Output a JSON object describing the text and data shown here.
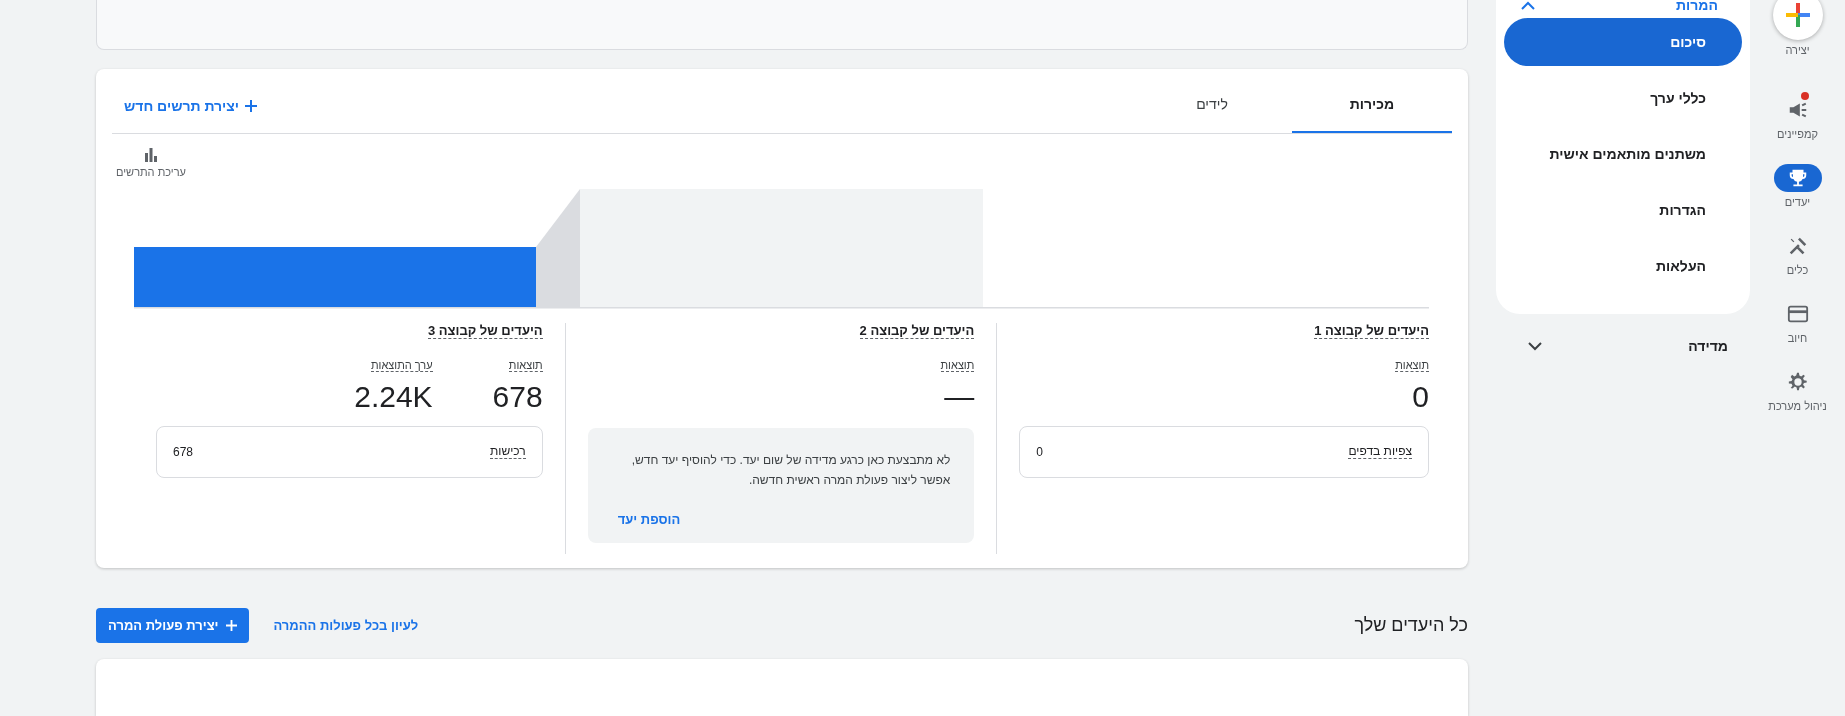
{
  "rail": [
    {
      "label": "יצירה",
      "kind": "create",
      "selected": false,
      "notification": false
    },
    {
      "label": "קמפיינים",
      "kind": "campaigns",
      "selected": false,
      "notification": true
    },
    {
      "label": "יעדים",
      "kind": "goals",
      "selected": true,
      "notification": false
    },
    {
      "label": "כלים",
      "kind": "tools",
      "selected": false,
      "notification": false
    },
    {
      "label": "חיוב",
      "kind": "billing",
      "selected": false,
      "notification": false
    },
    {
      "label": "ניהול מערכת",
      "kind": "admin",
      "selected": false,
      "notification": false
    }
  ],
  "nav": {
    "title": "המרות",
    "expanded": true,
    "items": [
      {
        "label": "סיכום",
        "selected": true
      },
      {
        "label": "כללי ערך",
        "selected": false
      },
      {
        "label": "משתנים מותאמים אישית",
        "selected": false
      },
      {
        "label": "הגדרות",
        "selected": false
      },
      {
        "label": "העלאות",
        "selected": false
      }
    ],
    "section": {
      "label": "מדידה",
      "expanded": false
    }
  },
  "chart_card": {
    "tabs": [
      {
        "label": "מכירות",
        "selected": true
      },
      {
        "label": "לידים",
        "selected": false
      }
    ],
    "new_chart": "יצירת תרשים חדש",
    "edit_chart": "עריכת התרשים",
    "groups": [
      {
        "title": "היעדים של קבוצה 1",
        "metrics": [
          {
            "label": "תוצאות",
            "value": "0"
          }
        ],
        "breakdown": {
          "label": "צפיות בדפים",
          "value": "0"
        }
      },
      {
        "title": "היעדים של קבוצה 2",
        "metrics": [
          {
            "label": "תוצאות",
            "value": "—"
          }
        ],
        "notice": {
          "text": "לא מתבצעת כאן כרגע מדידה של שום יעד. כדי להוסיף יעד חדש, אפשר ליצור פעולת המרה ראשית חדשה.",
          "action": "הוספת יעד"
        }
      },
      {
        "title": "היעדים של קבוצה 3",
        "metrics": [
          {
            "label": "תוצאות",
            "value": "678"
          },
          {
            "label": "ערך התוצאות",
            "value": "2.24K"
          }
        ],
        "breakdown": {
          "label": "רכישות",
          "value": "678"
        }
      }
    ]
  },
  "goals_section": {
    "title": "כל היעדים שלך",
    "link": "לעיון בכל פעולות ההמרה",
    "create_button": "יצירת פעולת המרה"
  }
}
